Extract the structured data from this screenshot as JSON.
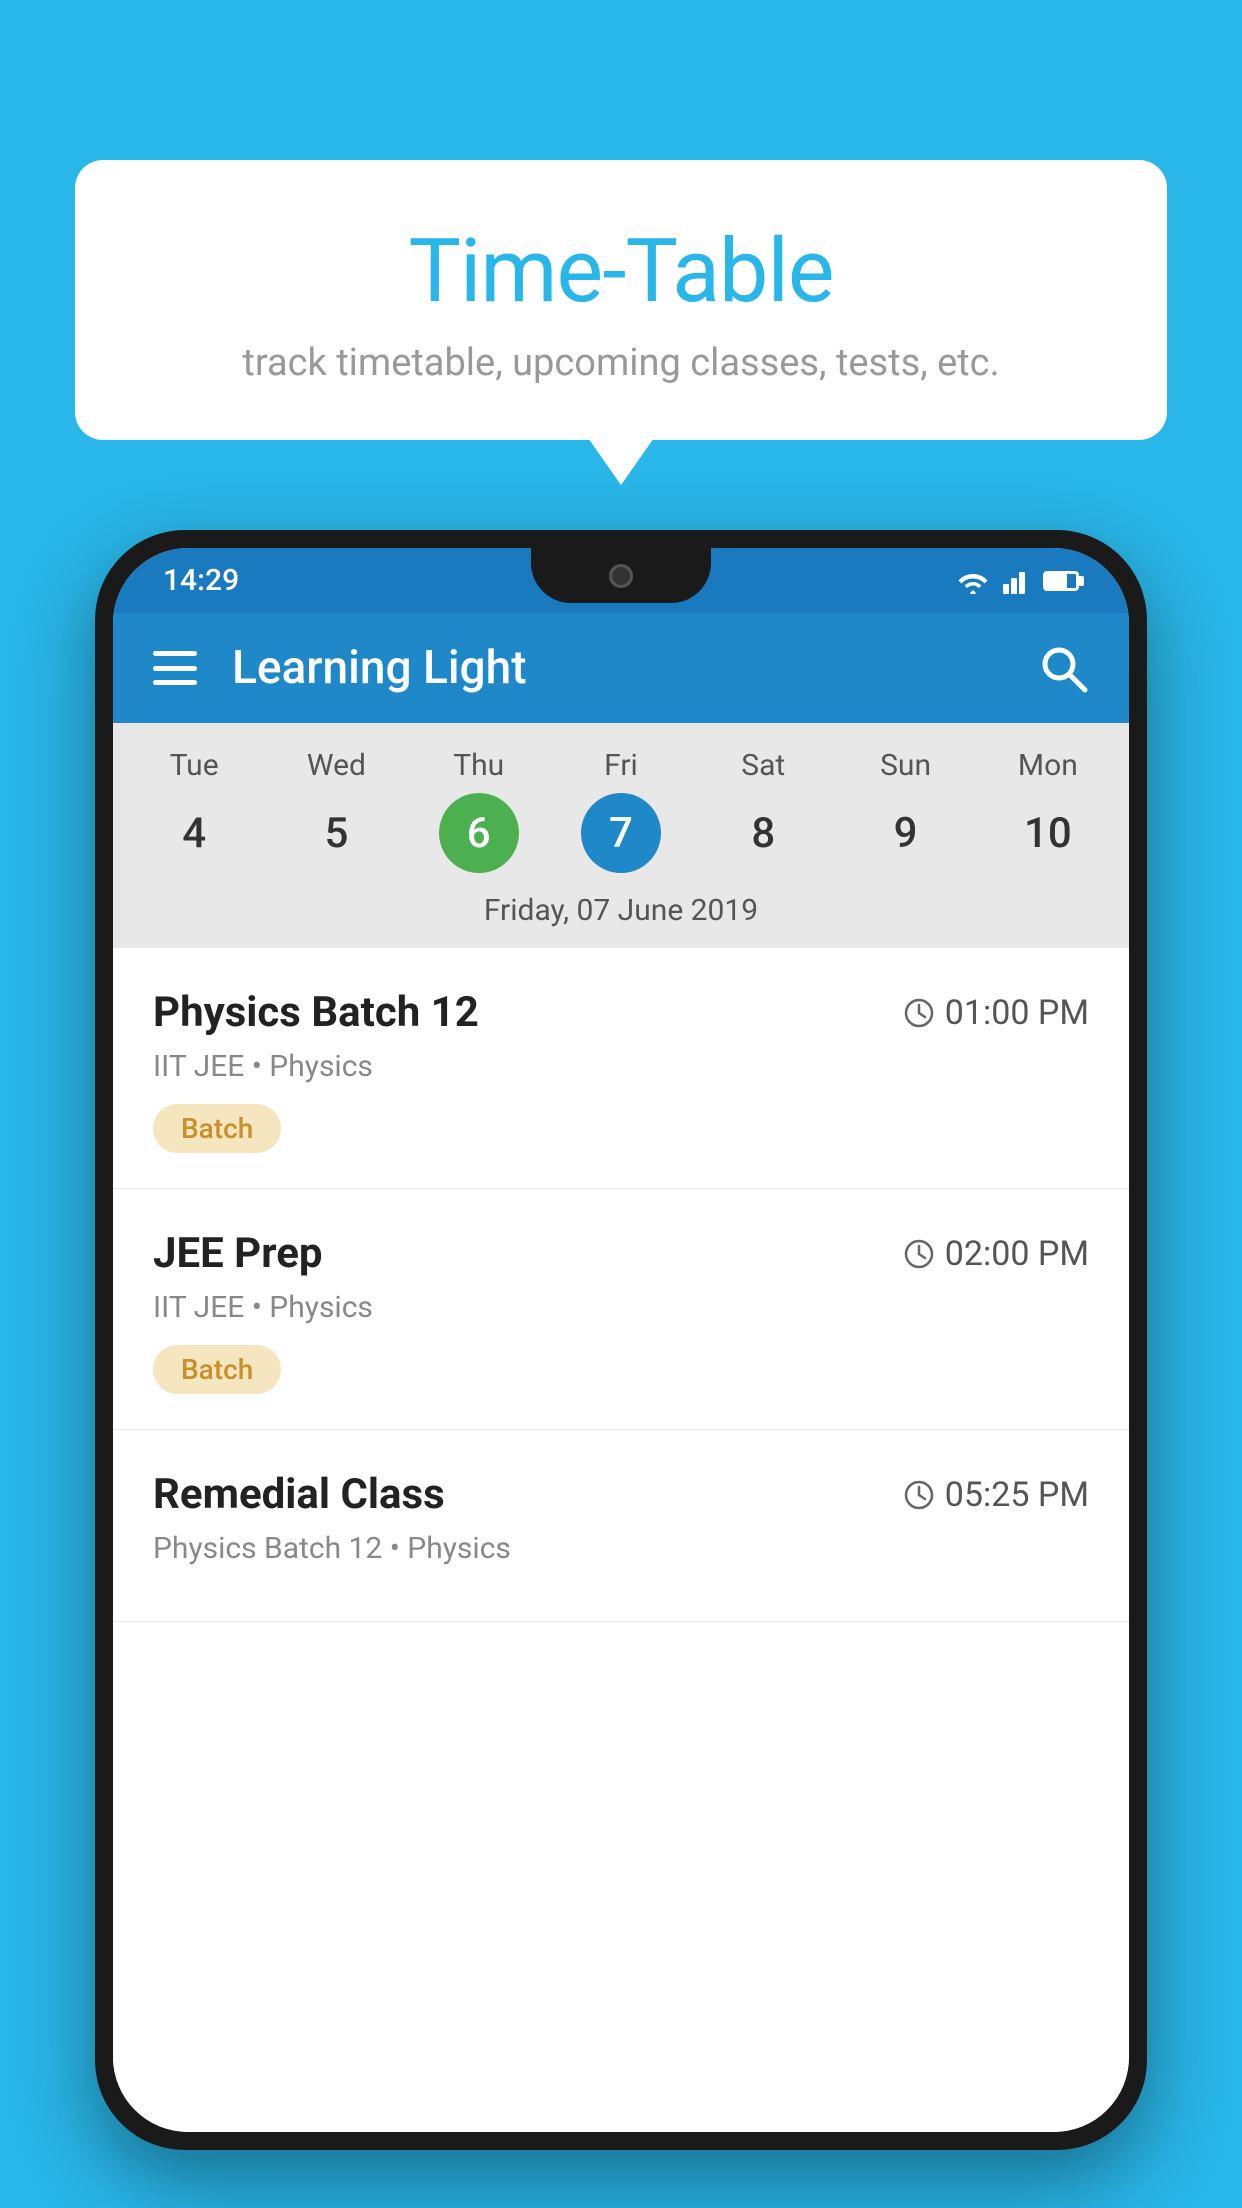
{
  "background_color": "#29b6e8",
  "bubble": {
    "title": "Time-Table",
    "subtitle": "track timetable, upcoming classes, tests, etc."
  },
  "phone": {
    "status_bar": {
      "time": "14:29"
    },
    "app_bar": {
      "title": "Learning Light"
    },
    "calendar": {
      "days": [
        "Tue",
        "Wed",
        "Thu",
        "Fri",
        "Sat",
        "Sun",
        "Mon"
      ],
      "dates": [
        "4",
        "5",
        "6",
        "7",
        "8",
        "9",
        "10"
      ],
      "today_index": 2,
      "selected_index": 3,
      "selected_date_label": "Friday, 07 June 2019"
    },
    "schedule_items": [
      {
        "name": "Physics Batch 12",
        "time": "01:00 PM",
        "meta": "IIT JEE • Physics",
        "badge": "Batch"
      },
      {
        "name": "JEE Prep",
        "time": "02:00 PM",
        "meta": "IIT JEE • Physics",
        "badge": "Batch"
      },
      {
        "name": "Remedial Class",
        "time": "05:25 PM",
        "meta": "Physics Batch 12 • Physics",
        "badge": null
      }
    ]
  }
}
